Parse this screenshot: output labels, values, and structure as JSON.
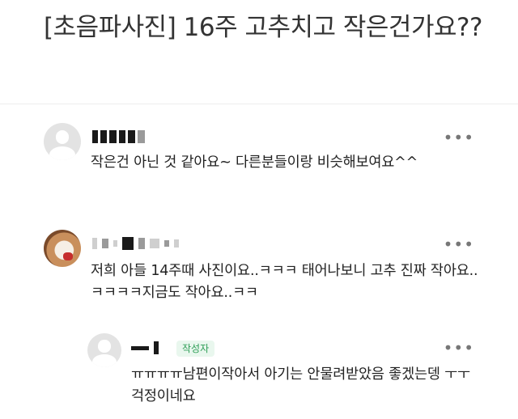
{
  "post": {
    "title": "[초음파사진] 16주 고추치고 작은건가요??"
  },
  "comments": [
    {
      "avatar_icon": "default-avatar-icon",
      "text": "작은건 아닌 것 같아요~ 다른분들이랑 비슷해보여요^^",
      "more_label": "•••"
    },
    {
      "avatar_icon": "profile-photo",
      "text": "저희 아들 14주때 사진이요..ㅋㅋㅋ 태어나보니 고추 진짜 작아요..ㅋㅋㅋㅋ지금도 작아요..ㅋㅋ",
      "more_label": "•••"
    },
    {
      "avatar_icon": "default-avatar-icon",
      "badge": "작성자",
      "text": "ㅠㅠㅠㅠ남편이작아서 아기는 안물려받았음 좋겠는뎅 ㅜㅜ걱정이네요",
      "more_label": "•••"
    }
  ],
  "colors": {
    "badge_text": "#2e9e56",
    "badge_bg": "#e9f7ee",
    "divider": "#eeeeee"
  }
}
